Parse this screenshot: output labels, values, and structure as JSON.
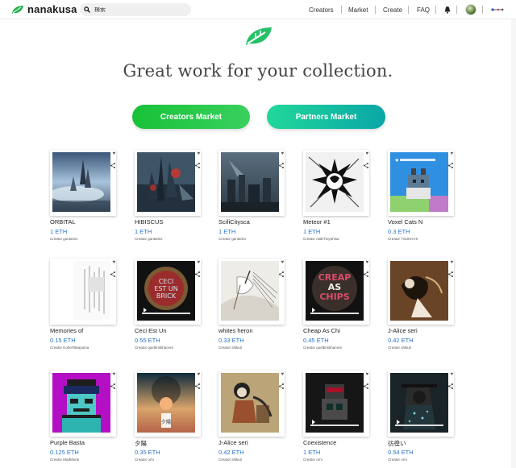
{
  "nav": {
    "brand": "nanakusa",
    "search_placeholder": "検索",
    "menu": [
      "Creators",
      "Market",
      "Create",
      "FAQ"
    ]
  },
  "hero": {
    "title": "Great work for your collection.",
    "creators_button": "Creators Market",
    "partners_button": "Partners Market"
  },
  "colors": {
    "brand_green": "#21b24a",
    "price_blue": "#2a73c9"
  },
  "cards": [
    {
      "title": "ORBITAL",
      "price": "1 ETH",
      "creator": "Creator guntamix"
    },
    {
      "title": "HIBISCUS",
      "price": "1 ETH",
      "creator": "Creator guntamix"
    },
    {
      "title": "ScifiCitysca",
      "price": "1 ETH",
      "creator": "Creator guntamix"
    },
    {
      "title": "Meteor #1",
      "price": "1 ETH",
      "creator": "Creator ABETtoyohisa"
    },
    {
      "title": "Voxel Cats N",
      "price": "0.3 ETH",
      "creator": "Creator TSUKICHI"
    },
    {
      "title": "Memories of",
      "price": "0.15 ETH",
      "creator": "Creator KoheiTakayama"
    },
    {
      "title": "Ceci Est Un",
      "price": "0.55 ETH",
      "creator": "Creator quelbriskhacent"
    },
    {
      "title": "whites heron",
      "price": "0.33 ETH",
      "creator": "Creator shikuri"
    },
    {
      "title": "Cheap As Chi",
      "price": "0.45 ETH",
      "creator": "Creator quelbriskhacent"
    },
    {
      "title": "J-Alice seri",
      "price": "0.42 ETH",
      "creator": "Creator shikuri"
    },
    {
      "title": "Purple Basta",
      "price": "0.125 ETH",
      "creator": "Creator MadMonk"
    },
    {
      "title": "夕陽",
      "price": "0.35 ETH",
      "creator": "Creator orni"
    },
    {
      "title": "J-Alice seri",
      "price": "0.42 ETH",
      "creator": "Creator shikuri"
    },
    {
      "title": "Coexistence",
      "price": "1 ETH",
      "creator": "Creator orni"
    },
    {
      "title": "彷徨い",
      "price": "0.54 ETH",
      "creator": "Creator orni"
    }
  ],
  "card_art": [
    "orbital-art",
    "hibiscus-art",
    "scifi-city-art",
    "meteor-art",
    "voxel-cats-art",
    "memories-art",
    "ceci-est-un-art",
    "whites-heron-art",
    "cheap-as-chips-art",
    "j-alice-art",
    "purple-basta-art",
    "yuuhi-art",
    "j-alice-art-2",
    "coexistence-art",
    "samayoi-art"
  ]
}
